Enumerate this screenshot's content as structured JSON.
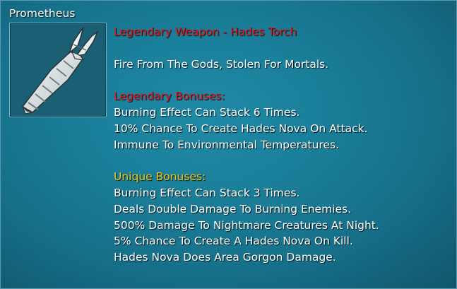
{
  "item": {
    "name": "Prometheus",
    "icon": "hades-torch-icon",
    "header": "Legendary Weapon - Hades Torch",
    "flavor": "Fire From The Gods, Stolen For Mortals.",
    "legendary_title": "Legendary Bonuses:",
    "legendary_bonuses": [
      "Burning Effect Can Stack 6 Times.",
      "10% Chance To Create Hades Nova On Attack.",
      "Immune To Environmental Temperatures."
    ],
    "unique_title": "Unique Bonuses:",
    "unique_bonuses": [
      "Burning Effect Can Stack 3 Times.",
      "Deals Double Damage To Burning Enemies.",
      "500% Damage To Nightmare Creatures At Night.",
      "5% Chance To Create A Hades Nova On Kill.",
      "Hades Nova Does Area Gorgon Damage."
    ]
  },
  "colors": {
    "background": "#1a7e99",
    "legendary_red": "#e5141b",
    "unique_gold": "#f2c616",
    "text": "#ffffff"
  }
}
